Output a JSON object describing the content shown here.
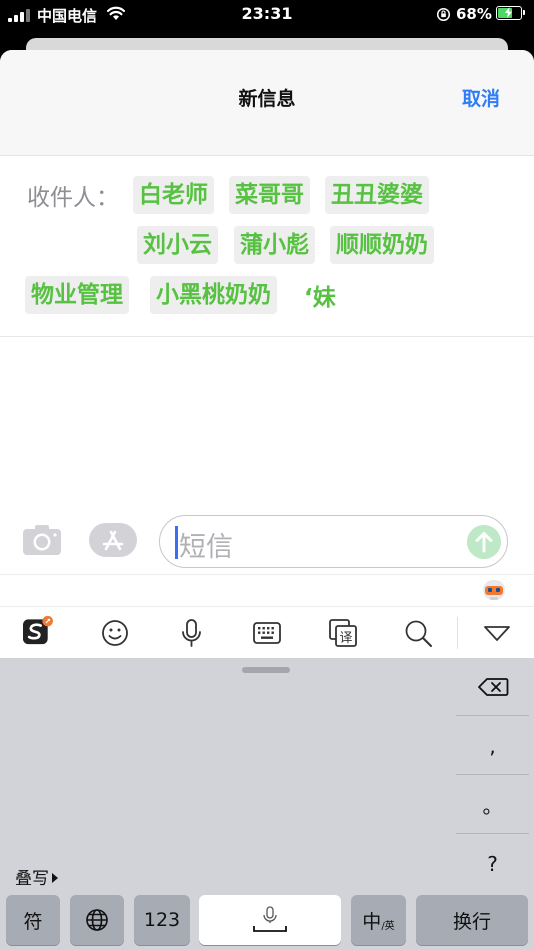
{
  "status_bar": {
    "carrier": "中国电信",
    "time": "23:31",
    "battery_percent": "68%",
    "battery_level": 0.68,
    "charging": true,
    "signal_bars": 3
  },
  "nav": {
    "title": "新信息",
    "cancel_label": "取消"
  },
  "recipients": {
    "label": "收件人：",
    "chips": [
      "白老师",
      "菜哥哥",
      "丑丑婆婆",
      "刘小云",
      "蒲小彪",
      "顺顺奶奶",
      "物业管理",
      "小黑桃奶奶"
    ],
    "typing_text": "‘妹"
  },
  "compose": {
    "placeholder": "短信"
  },
  "toolbar": {
    "icons": [
      "sogou-logo-icon",
      "emoji-icon",
      "microphone-icon",
      "keyboard-icon",
      "translate-icon",
      "search-icon",
      "collapse-icon"
    ]
  },
  "keyboard": {
    "side_keys": [
      ",",
      "。",
      "?"
    ],
    "stack_label": "叠写",
    "bottom_row": {
      "symbols": "符",
      "numbers": "123",
      "lang_main": "中",
      "lang_sub": "/英",
      "return": "换行"
    }
  },
  "colors": {
    "recipient_green": "#57c242",
    "accent_blue": "#2f7cf6",
    "keyboard_bg": "#d1d3d9"
  }
}
